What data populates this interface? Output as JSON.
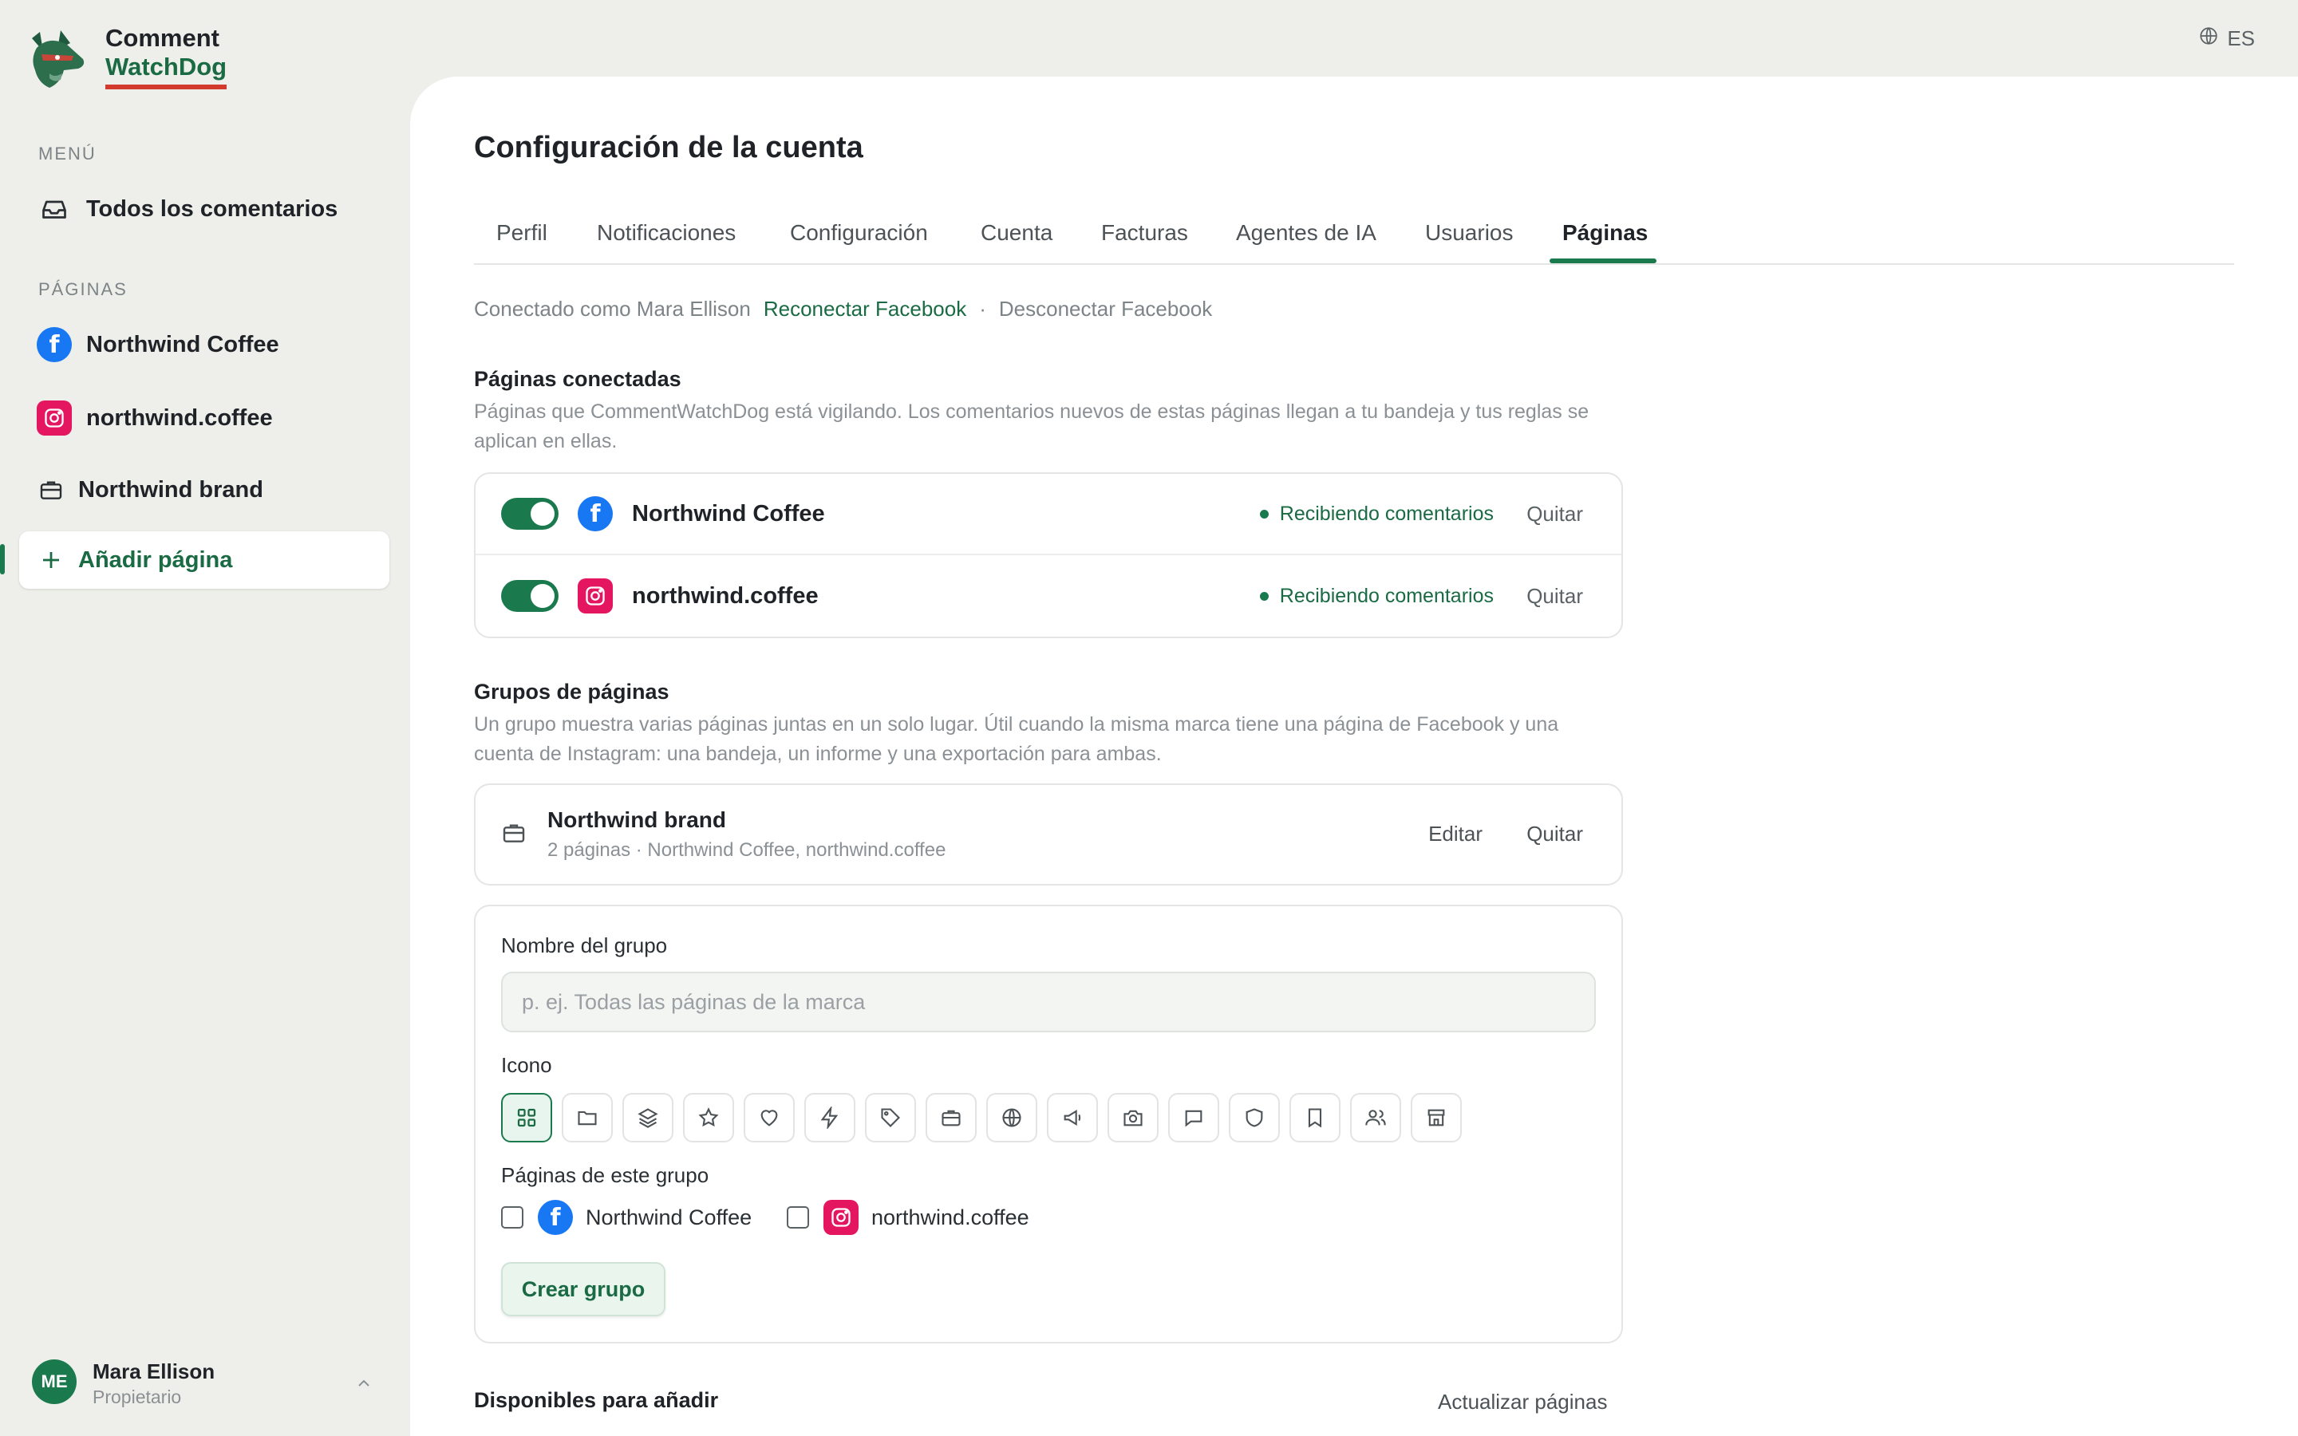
{
  "app": {
    "name_line1": "Comment",
    "name_line2": "WatchDog",
    "lang": "ES"
  },
  "sidebar": {
    "menu_heading": "MENÚ",
    "all_comments": "Todos los comentarios",
    "pages_heading": "PÁGINAS",
    "items": [
      {
        "label": "Northwind Coffee",
        "icon": "facebook-icon"
      },
      {
        "label": "northwind.coffee",
        "icon": "instagram-icon"
      },
      {
        "label": "Northwind brand",
        "icon": "briefcase-icon"
      }
    ],
    "add_page": "Añadir página",
    "user": {
      "initials": "ME",
      "name": "Mara Ellison",
      "role": "Propietario"
    }
  },
  "main": {
    "title": "Configuración de la cuenta",
    "tabs": [
      "Perfil",
      "Notificaciones",
      "Configuración",
      "Cuenta",
      "Facturas",
      "Agentes de IA",
      "Usuarios",
      "Páginas"
    ],
    "active_tab": "Páginas",
    "connection": {
      "connected_as": "Conectado como Mara Ellison",
      "reconnect": "Reconectar Facebook",
      "separator": "·",
      "disconnect": "Desconectar Facebook"
    },
    "connected_pages": {
      "title": "Páginas conectadas",
      "description": "Páginas que CommentWatchDog está vigilando. Los comentarios nuevos de estas páginas llegan a tu bandeja y tus reglas se aplican en ellas.",
      "rows": [
        {
          "name": "Northwind Coffee",
          "platform": "facebook",
          "enabled": true,
          "status": "Recibiendo comentarios",
          "remove": "Quitar"
        },
        {
          "name": "northwind.coffee",
          "platform": "instagram",
          "enabled": true,
          "status": "Recibiendo comentarios",
          "remove": "Quitar"
        }
      ]
    },
    "groups": {
      "title": "Grupos de páginas",
      "description": "Un grupo muestra varias páginas juntas en un solo lugar. Útil cuando la misma marca tiene una página de Facebook y una cuenta de Instagram: una bandeja, un informe y una exportación para ambas.",
      "existing": {
        "name": "Northwind brand",
        "meta": "2 páginas · Northwind Coffee, northwind.coffee",
        "edit": "Editar",
        "remove": "Quitar"
      },
      "form": {
        "name_label": "Nombre del grupo",
        "name_placeholder": "p. ej. Todas las páginas de la marca",
        "icon_label": "Icono",
        "icons": [
          "grid-icon",
          "folder-icon",
          "layers-icon",
          "star-icon",
          "heart-icon",
          "bolt-icon",
          "tag-icon",
          "briefcase-icon",
          "globe-icon",
          "megaphone-icon",
          "camera-icon",
          "chat-icon",
          "shield-icon",
          "bookmark-icon",
          "users-icon",
          "store-icon"
        ],
        "selected_icon": "grid-icon",
        "pages_label": "Páginas de este grupo",
        "page_options": [
          "Northwind Coffee",
          "northwind.coffee"
        ],
        "create_button": "Crear grupo"
      }
    },
    "available": {
      "title": "Disponibles para añadir",
      "refresh": "Actualizar páginas"
    }
  },
  "colors": {
    "accent": "#1a7a4e",
    "facebook": "#1877f2",
    "instagram": "#e4165f",
    "logo_underline": "#d23a2d"
  }
}
